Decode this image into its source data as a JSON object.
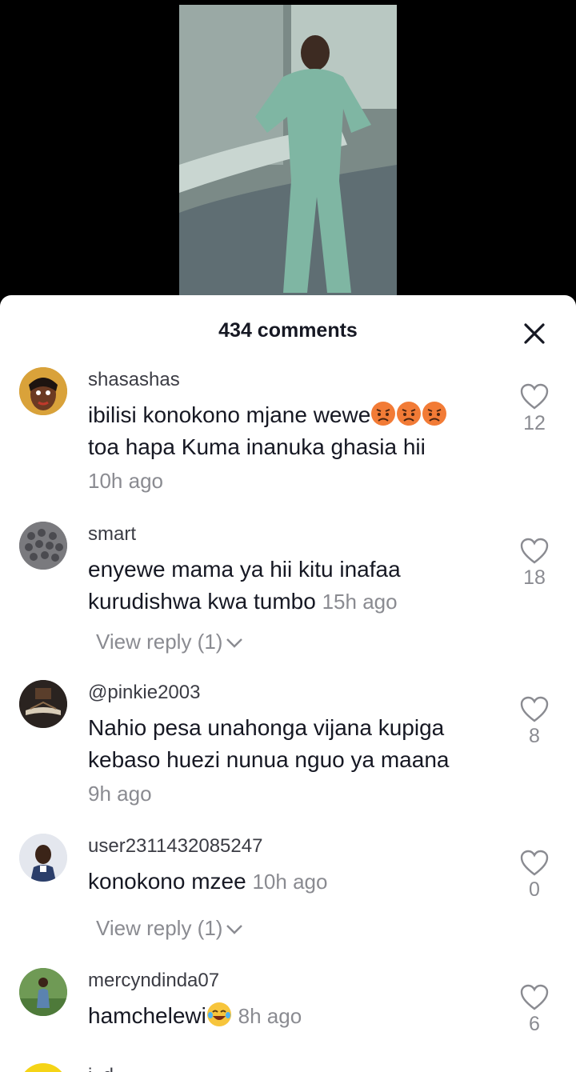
{
  "sheet": {
    "title": "434 comments"
  },
  "comments": [
    {
      "user": "shasashas",
      "text": "ibilisi konokono mjane wewe",
      "text_cont": "toa hapa Kuma inanuka ghasia hii",
      "time": "10h ago",
      "likes": "12"
    },
    {
      "user": "smart",
      "text": "enyewe mama ya hii kitu inafaa",
      "text_cont": "kurudishwa kwa tumbo",
      "time": "15h ago",
      "likes": "18",
      "view_reply": "View reply (1)"
    },
    {
      "user": "@pinkie2003",
      "text": "Nahio pesa unahonga vijana kupiga",
      "text_cont": "kebaso huezi nunua nguo ya maana",
      "time": "9h ago",
      "likes": "8"
    },
    {
      "user": "user2311432085247",
      "text": "konokono mzee",
      "time": "10h ago",
      "likes": "0",
      "view_reply": "View reply (1)"
    },
    {
      "user": "mercyndinda07",
      "text": "hamchelewi",
      "time": "8h ago",
      "likes": "6"
    },
    {
      "user": "i_d"
    }
  ]
}
